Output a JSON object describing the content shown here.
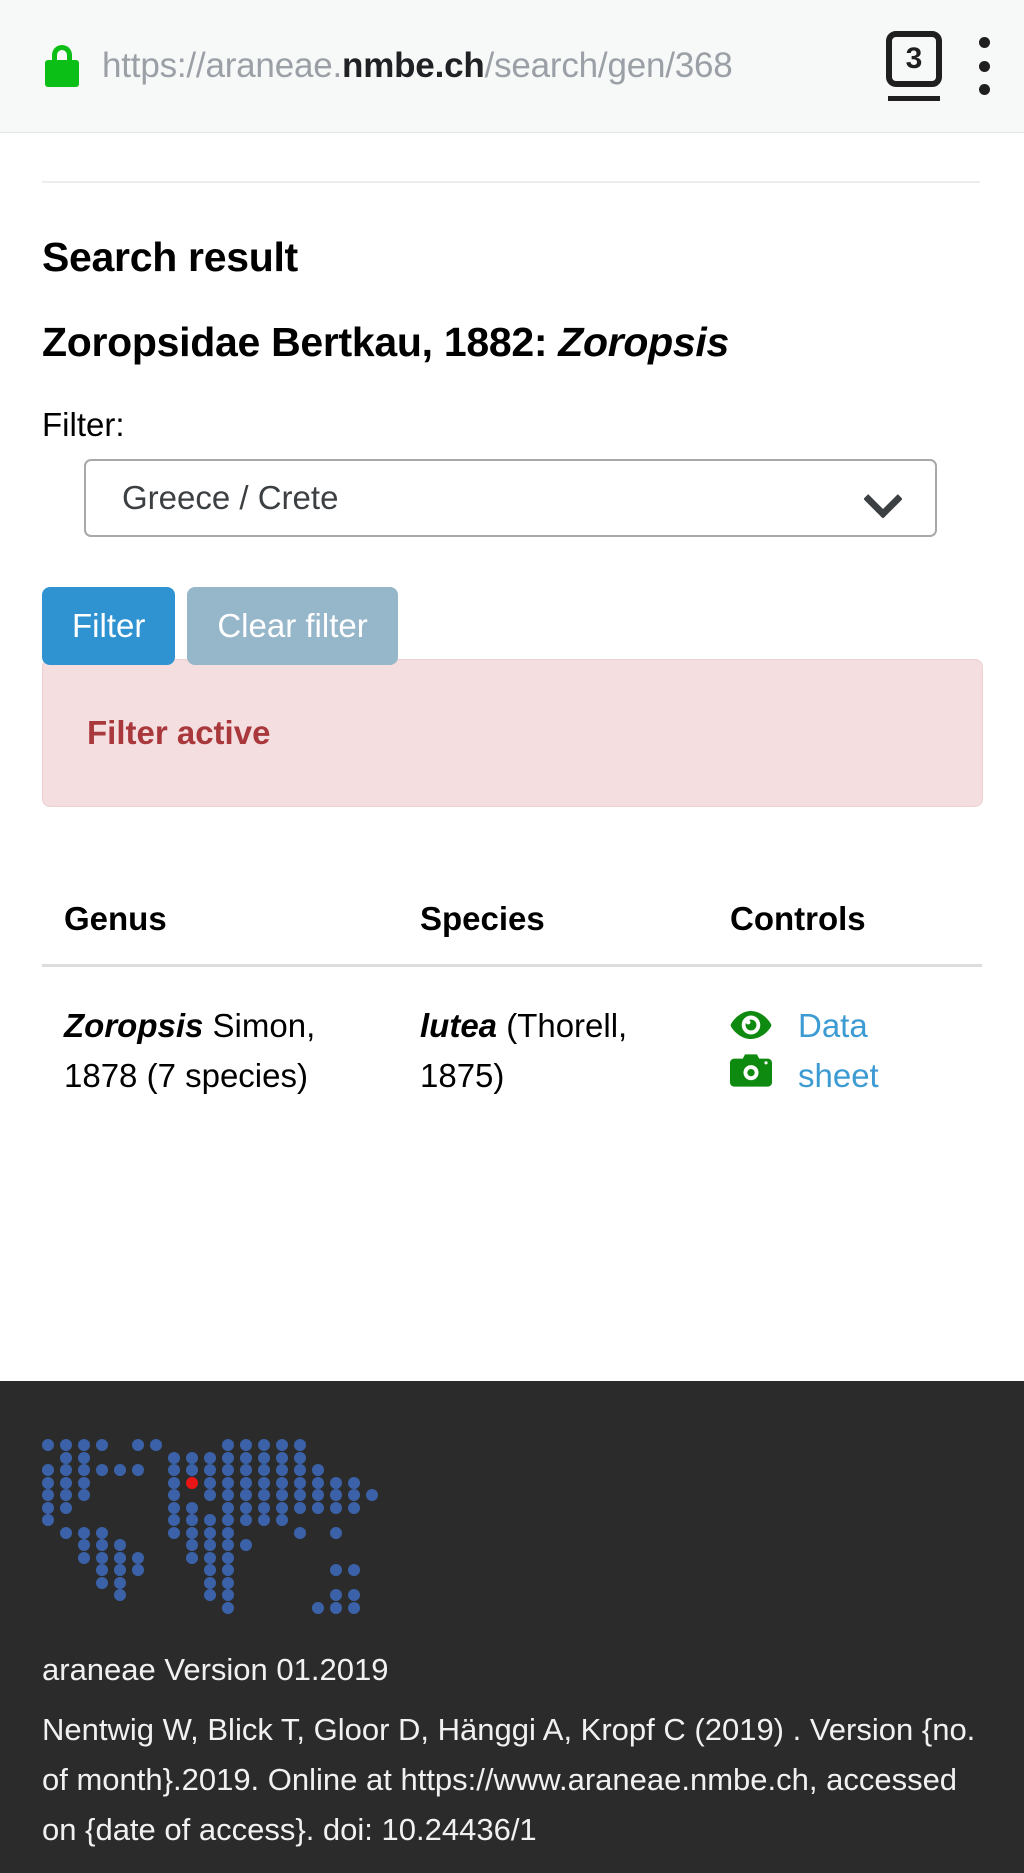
{
  "browser": {
    "lock_icon": "lock-icon",
    "url_prefix": "https://araneae.",
    "url_domain": "nmbe.ch",
    "url_suffix": "/search/gen/368",
    "tab_count": "3",
    "menu_icon": "kebab-menu-icon"
  },
  "page": {
    "heading": "Search result",
    "taxon_prefix": "Zoropsidae Bertkau, 1882: ",
    "taxon_genus": "Zoropsis"
  },
  "filter": {
    "label": "Filter:",
    "selected_value": "Greece / Crete",
    "dropdown_icon": "chevron-down-icon",
    "apply_label": "Filter",
    "clear_label": "Clear filter",
    "status_text": "Filter active",
    "status_bg": "#f4dedf",
    "status_color": "#a9383d",
    "primary_color": "#2f93d1",
    "muted_color": "#96b6ca"
  },
  "results_table": {
    "columns": [
      "Genus",
      "Species",
      "Controls"
    ],
    "rows": [
      {
        "genus_name": "Zoropsis",
        "genus_author": " Simon, 1878 (7 species)",
        "species_name": "lutea",
        "species_author": " (Thorell, 1875)",
        "control_icons": [
          "eye-icon",
          "camera-icon"
        ],
        "control_link": "Data sheet",
        "link_color": "#3d9bd4",
        "icon_color": "#0f8a10"
      }
    ]
  },
  "footer": {
    "logo_icon": "dotted-world-map-logo",
    "logo_dot_color": "#3b62a8",
    "logo_highlight_color": "#e81616",
    "version": "araneae Version 01.2019",
    "citation": "Nentwig W, Blick T, Gloor D, Hänggi A, Kropf C (2019) . Version {no. of month}.2019. Online at https://www.araneae.nmbe.ch, accessed on {date of access}. doi: 10.24436/1"
  }
}
